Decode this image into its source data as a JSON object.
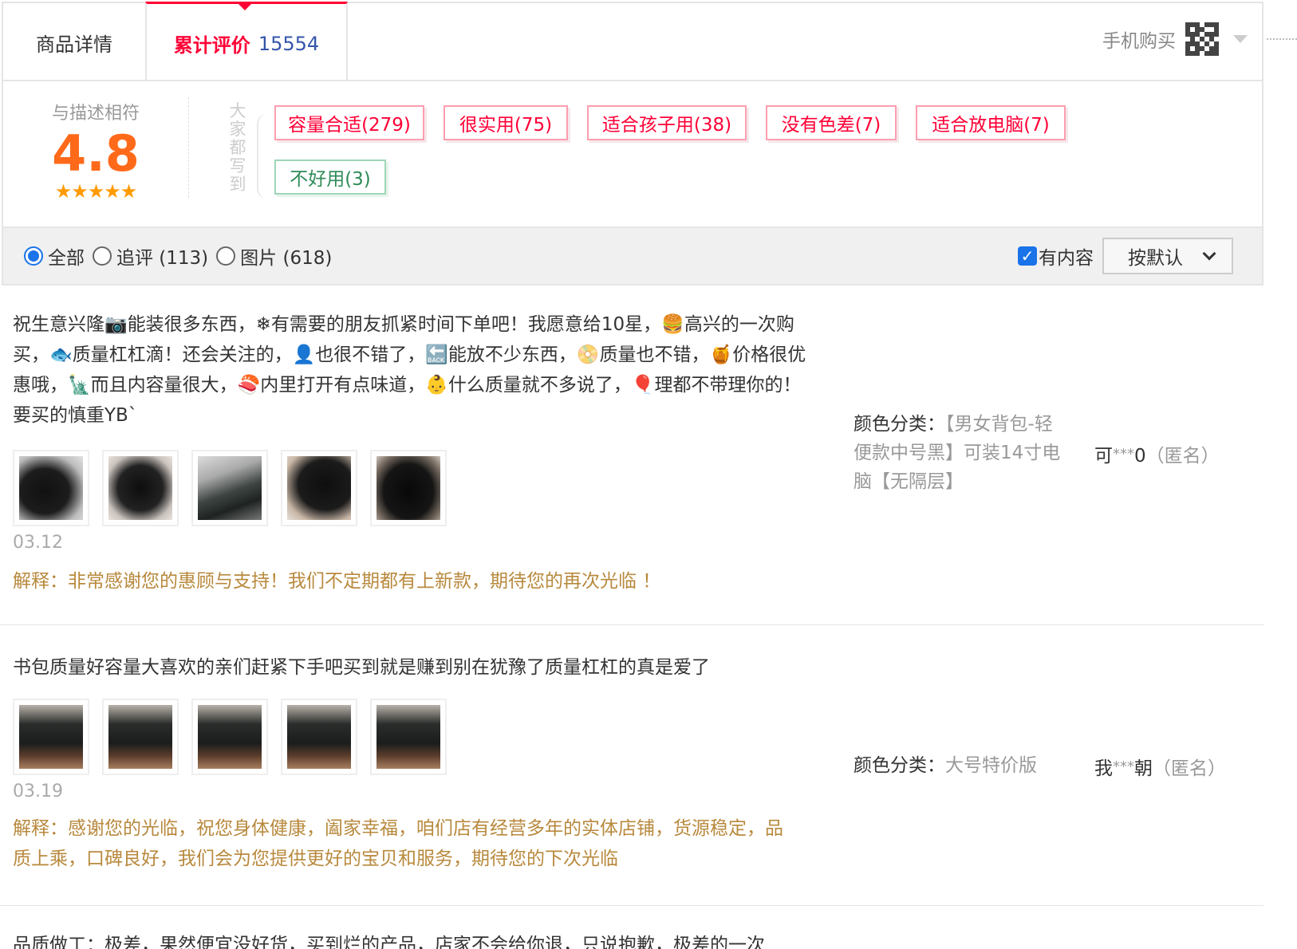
{
  "tabs": {
    "details_label": "商品详情",
    "reviews_label": "累计评价",
    "reviews_count": "15554",
    "mobile_buy": "手机购买"
  },
  "summary": {
    "score_label": "与描述相符",
    "score": "4.8",
    "stars": "★★★★★",
    "everyone_wrote": [
      "大",
      "家",
      "都",
      "写",
      "到"
    ],
    "tags": [
      {
        "label": "容量合适(279)",
        "sentiment": "positive"
      },
      {
        "label": "很实用(75)",
        "sentiment": "positive"
      },
      {
        "label": "适合孩子用(38)",
        "sentiment": "positive"
      },
      {
        "label": "没有色差(7)",
        "sentiment": "positive"
      },
      {
        "label": "适合放电脑(7)",
        "sentiment": "positive"
      },
      {
        "label": "不好用(3)",
        "sentiment": "negative"
      }
    ]
  },
  "filters": {
    "all_label": "全部",
    "followup_label": "追评 (113)",
    "images_label": "图片 (618)",
    "has_content_label": "有内容",
    "sort_label": "按默认"
  },
  "reviews": [
    {
      "text": "祝生意兴隆📷能装很多东西，❄有需要的朋友抓紧时间下单吧！我愿意给10星，🍔高兴的一次购买，🐟质量杠杠滴！还会关注的，👤也很不错了，🔙能放不少东西，📀质量也不错，🍯价格很优惠哦，🗽而且内容量很大，🍣内里打开有点味道，👶什么质量就不多说了，🎈理都不带理你的！要买的慎重YB`",
      "date": "03.12",
      "reply": "解释：非常感谢您的惠顾与支持！我们不定期都有上新款，期待您的再次光临 ！",
      "sku_label": "颜色分类：",
      "sku_value": "【男女背包-轻便款中号黑】可装14寸电脑【无隔层】",
      "user_first": "可",
      "user_mask": "***",
      "user_last": "0",
      "anon": "（匿名）"
    },
    {
      "text": "书包质量好容量大喜欢的亲们赶紧下手吧买到就是赚到别在犹豫了质量杠杠的真是爱了",
      "date": "03.19",
      "reply": "解释：感谢您的光临，祝您身体健康，阖家幸福，咱们店有经营多年的实体店铺，货源稳定，品质上乘，口碑良好，我们会为您提供更好的宝贝和服务，期待您的下次光临",
      "sku_label": "颜色分类：",
      "sku_value": "大号特价版",
      "user_first": "我",
      "user_mask": "***",
      "user_last": "朝",
      "anon": "（匿名）"
    },
    {
      "text": "品质做工：极差，果然便宜没好货，买到烂的产品，店家不会给你退，只说抱歉，极差的一次"
    }
  ],
  "colors": {
    "accent_red": "#ff0036",
    "count_blue": "#3355aa",
    "score_orange": "#ff6a1a",
    "reply_brown": "#b8893d",
    "negative_green": "#2e8b57"
  }
}
